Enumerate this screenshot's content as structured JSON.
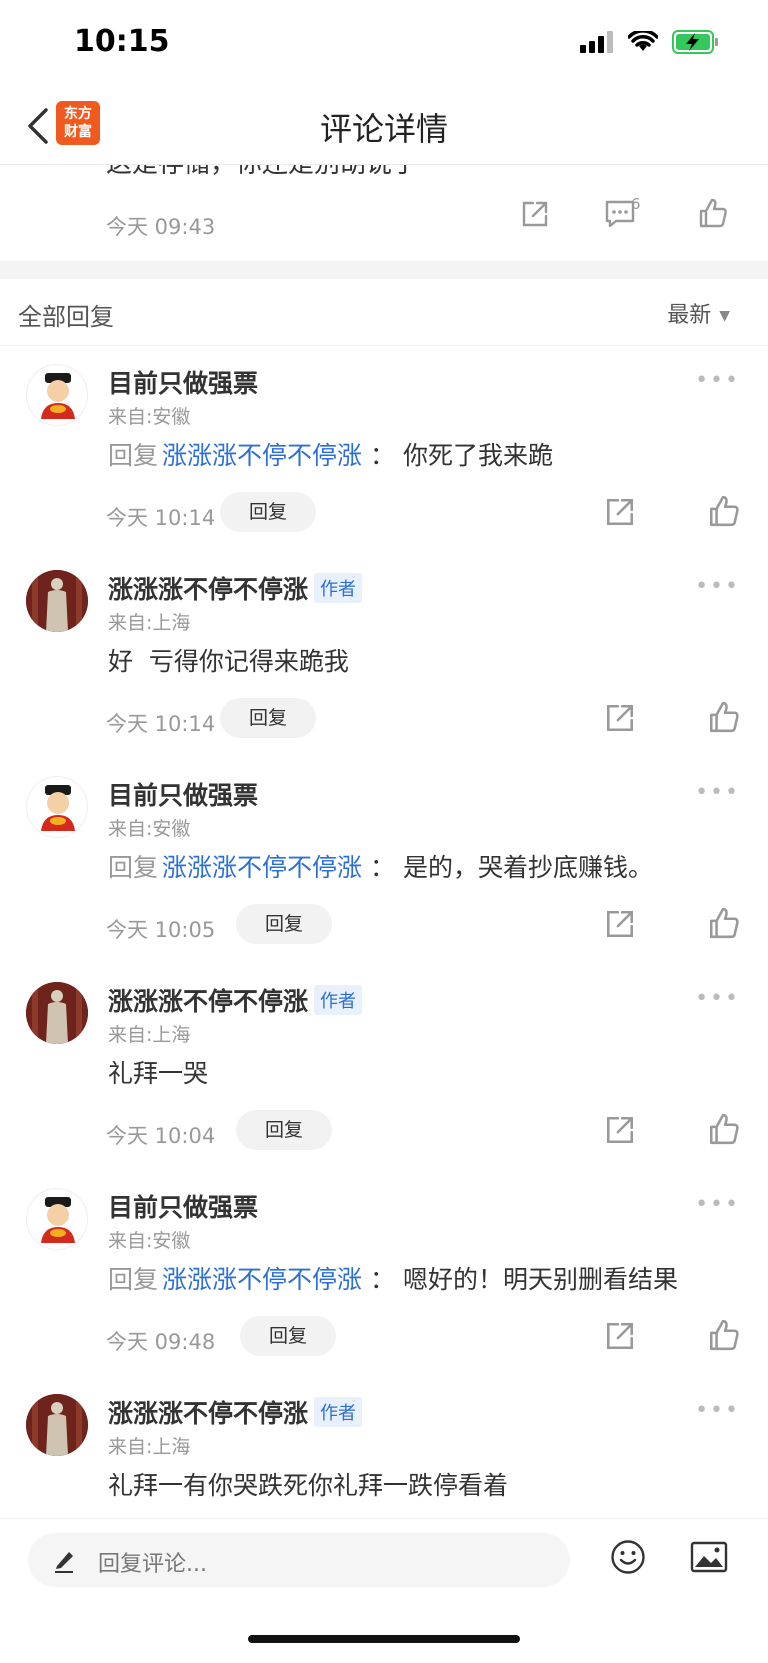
{
  "status_bar": {
    "time": "10:15"
  },
  "nav": {
    "title": "评论详情",
    "logo_line1": "东方",
    "logo_line2": "财富"
  },
  "prev_comment": {
    "text": "这是存储，你还是别胡说了",
    "time": "今天 09:43",
    "comment_count": "6"
  },
  "section": {
    "title": "全部回复",
    "sort_label": "最新"
  },
  "comments": [
    {
      "user": "目前只做强票",
      "location": "来自:安徽",
      "reply_prefix": "回复",
      "mention": "涨涨涨不停不停涨",
      "text": "你死了我来跪",
      "time": "今天 10:14",
      "reply_label": "回复",
      "is_author": false
    },
    {
      "user": "涨涨涨不停不停涨",
      "author_badge": "作者",
      "location": "来自:上海",
      "text": "好  亏得你记得来跪我",
      "time": "今天 10:14",
      "reply_label": "回复",
      "is_author": true
    },
    {
      "user": "目前只做强票",
      "location": "来自:安徽",
      "reply_prefix": "回复",
      "mention": "涨涨涨不停不停涨",
      "text": "是的，哭着抄底赚钱。",
      "time": "今天 10:05",
      "reply_label": "回复",
      "is_author": false
    },
    {
      "user": "涨涨涨不停不停涨",
      "author_badge": "作者",
      "location": "来自:上海",
      "text": "礼拜一哭",
      "time": "今天 10:04",
      "reply_label": "回复",
      "is_author": true
    },
    {
      "user": "目前只做强票",
      "location": "来自:安徽",
      "reply_prefix": "回复",
      "mention": "涨涨涨不停不停涨",
      "text": "嗯好的！明天别删看结果",
      "time": "今天 09:48",
      "reply_label": "回复",
      "is_author": false
    },
    {
      "user": "涨涨涨不停不停涨",
      "author_badge": "作者",
      "location": "来自:上海",
      "text": "礼拜一有你哭跌死你礼拜一跌停看着",
      "is_author": true
    }
  ],
  "bottom": {
    "placeholder": "回复评论..."
  },
  "colors": {
    "link_blue": "#2b6fd6",
    "brand_orange": "#f05a1e",
    "battery_green": "#34c759"
  }
}
